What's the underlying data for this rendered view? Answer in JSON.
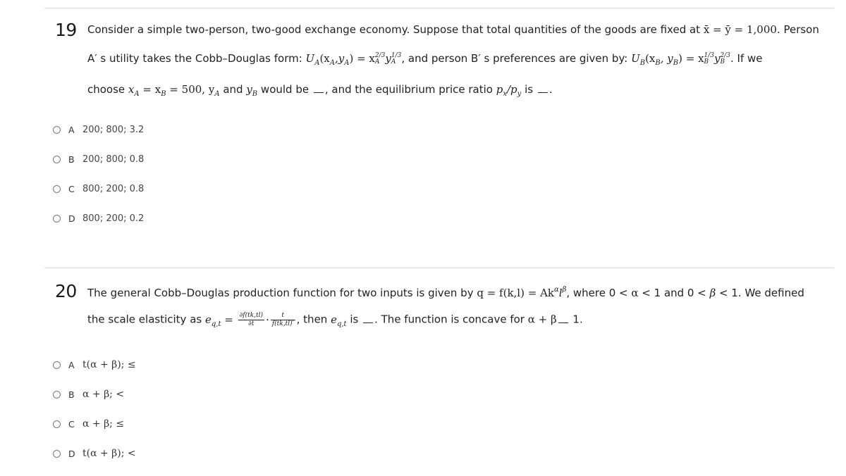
{
  "questions": [
    {
      "number": "19",
      "line1": "Consider a simple two-person, two-good exchange economy. Suppose that total quantities of the goods are fixed at ",
      "line1_math": "x̄ = ȳ = 1,000",
      "line1_end": ". Person",
      "line2_start": "A′  s utility takes the Cobb–Douglas form: ",
      "utility_a": {
        "lhs": "U",
        "lhs_sub": "A",
        "args": "(x",
        "args_sub1": "A",
        "args_mid": ",y",
        "args_sub2": "A",
        "args_end": ") = x",
        "exp1": "2/3",
        "base_sub1": "A",
        "y": "y",
        "exp2": "1/3",
        "base_sub2": "A"
      },
      "line2_mid": ", and person B′  s preferences are given by: ",
      "utility_b": {
        "lhs": "U",
        "lhs_sub": "B",
        "args": "(x",
        "args_sub1": "B",
        "args_mid": ", y",
        "args_sub2": "B",
        "args_end": ") = x",
        "exp1": "1/3",
        "base_sub1": "B",
        "y": "y",
        "exp2": "2/3",
        "base_sub2": "B"
      },
      "line2_end": ". If we",
      "line3_start": "choose ",
      "line3_math1": "x",
      "line3_sub1": "A",
      "line3_math2": " = x",
      "line3_sub2": "B",
      "line3_math3": " = 500, y",
      "line3_sub3": "A",
      "line3_and": " and ",
      "line3_yb": "y",
      "line3_yb_sub": "B",
      "line3_mid": " would be ",
      "line3_mid2": ", and the equilibrium price ratio ",
      "line3_px": "p",
      "line3_px_sub": "x",
      "line3_slash": "/p",
      "line3_py_sub": "y",
      "line3_is": " is ",
      "line3_end": ".",
      "options": [
        {
          "letter": "A",
          "text": "200; 800; 3.2"
        },
        {
          "letter": "B",
          "text": "200; 800; 0.8"
        },
        {
          "letter": "C",
          "text": "800; 200; 0.8"
        },
        {
          "letter": "D",
          "text": "800; 200; 0.2"
        }
      ]
    },
    {
      "number": "20",
      "line1": "The general Cobb–Douglas production function for two inputs is given by ",
      "line1_math": "q = f(k,l) = Ak",
      "line1_alpha": "α",
      "line1_l": "l",
      "line1_beta": "β",
      "line1_end": ", where 0 < ",
      "alpha": "α",
      "mid": " < 1 and 0 < ",
      "beta": "β",
      "end": " < 1. We defined",
      "line2_start": "the scale elasticity as ",
      "e": "e",
      "e_sub": "q,t",
      "eq": " = ",
      "frac1_num": "∂f(tk,tl)",
      "frac1_den": "∂t",
      "dot": "·",
      "frac2_num": "t",
      "frac2_den": "f(tk,tl)′",
      "line2_then": ", then ",
      "e2": "e",
      "e2_sub": "q,t",
      "line2_is": " is ",
      "line2_mid": ". The function is concave for ",
      "line2_ab": "α + β",
      "line2_end": " 1.",
      "options": [
        {
          "letter": "A",
          "text": "t(α + β); ≤"
        },
        {
          "letter": "B",
          "text": "α + β; <"
        },
        {
          "letter": "C",
          "text": "α + β; ≤"
        },
        {
          "letter": "D",
          "text": "t(α + β); <"
        }
      ]
    }
  ]
}
